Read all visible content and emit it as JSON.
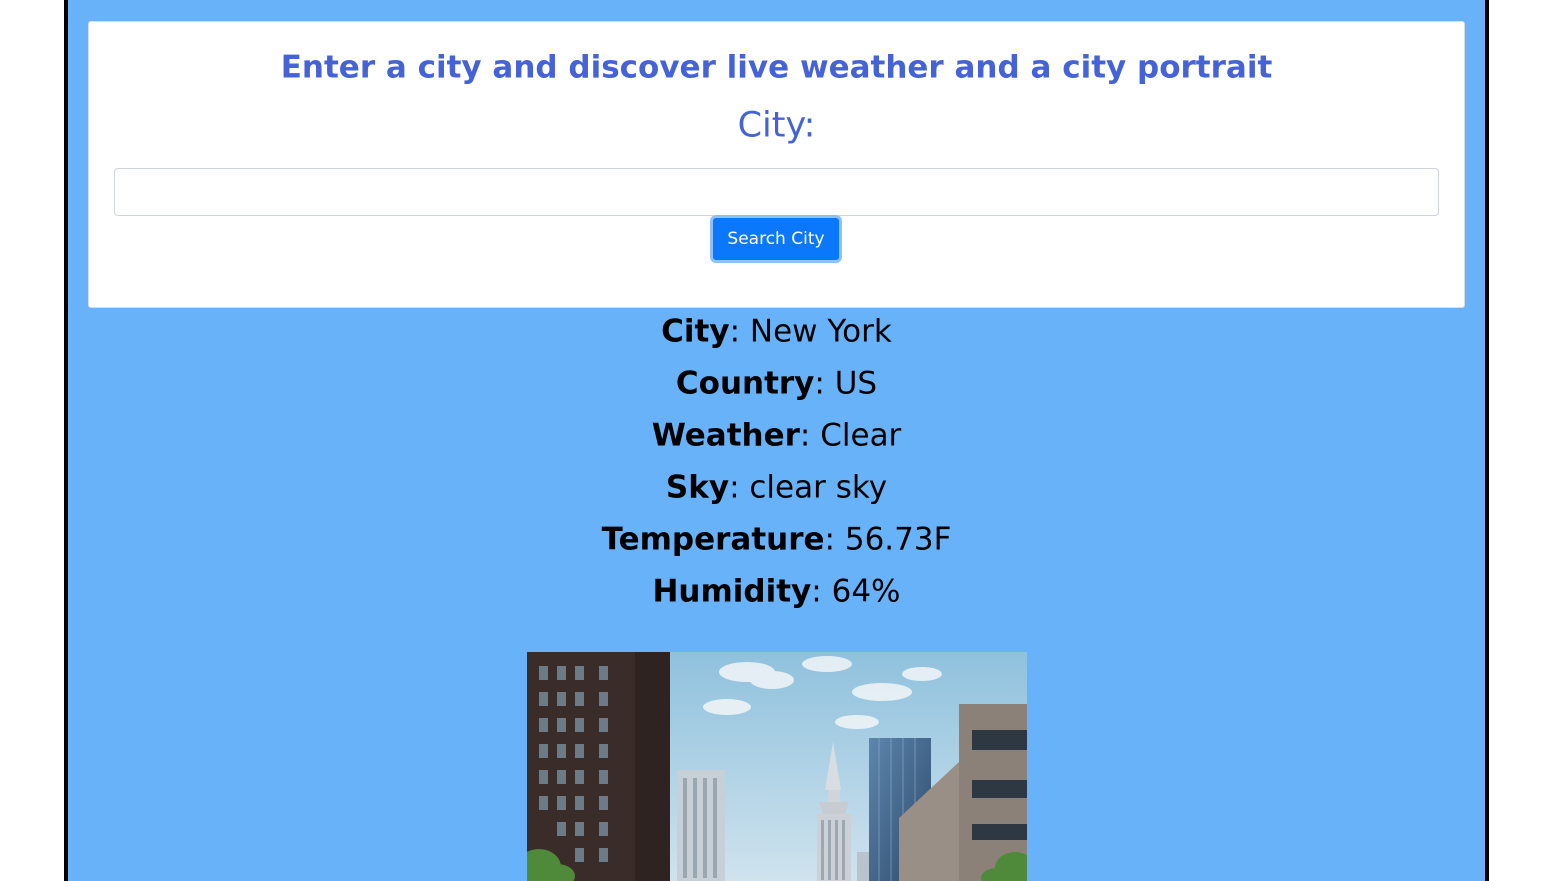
{
  "header": {
    "headline": "Enter a city and discover live weather and a city portrait",
    "city_label": "City:"
  },
  "search": {
    "value": "",
    "placeholder": "",
    "button_label": "Search City"
  },
  "weather": {
    "rows": [
      {
        "label": "City",
        "value": "New York"
      },
      {
        "label": "Country",
        "value": "US"
      },
      {
        "label": "Weather",
        "value": "Clear"
      },
      {
        "label": "Sky",
        "value": "clear sky"
      },
      {
        "label": "Temperature",
        "value": "56.73F"
      },
      {
        "label": "Humidity",
        "value": "64%"
      }
    ]
  },
  "colors": {
    "background": "#67b2f8",
    "heading": "#4563d6",
    "button": "#0b78fb"
  }
}
